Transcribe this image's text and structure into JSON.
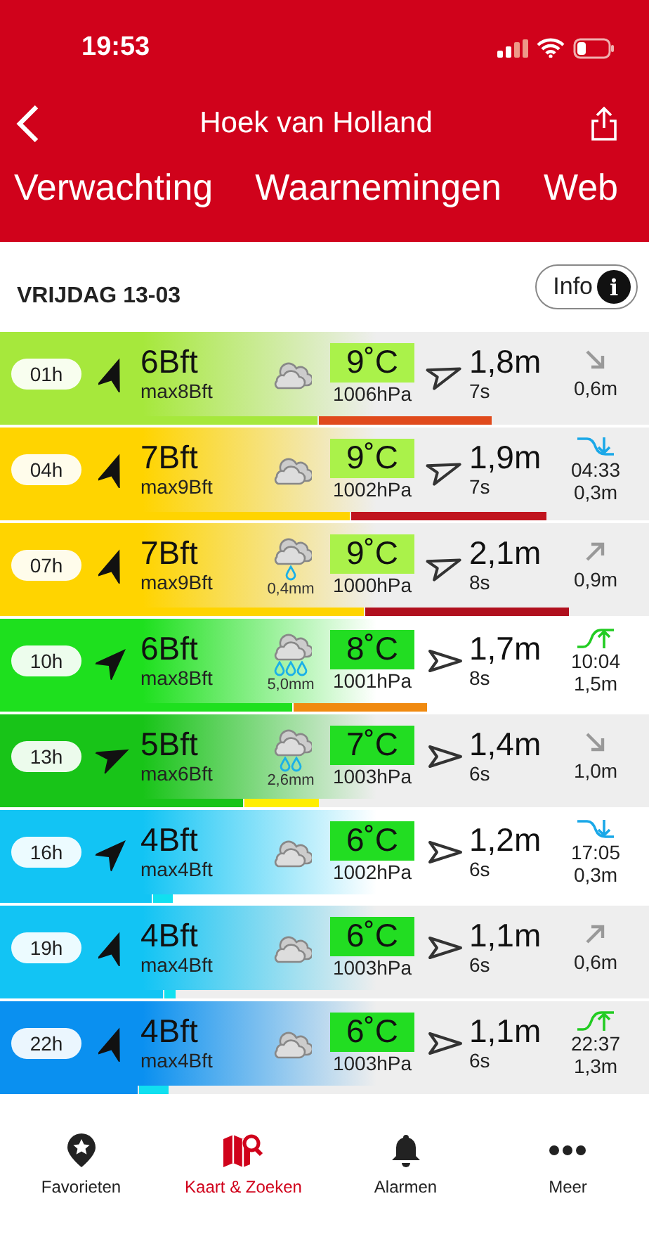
{
  "status_bar": {
    "time": "19:53"
  },
  "header": {
    "title": "Hoek van Holland"
  },
  "tabs": [
    "Verwachting",
    "Waarnemingen",
    "Web"
  ],
  "day": {
    "label": "VRIJDAG 13-03",
    "info_button": "Info",
    "info_icon": "i"
  },
  "rows": [
    {
      "hour": "01h",
      "shaded": true,
      "color": "#a6e83c",
      "wind": "6Bft",
      "gust": "max8Bft",
      "rain": {
        "kind": "none"
      },
      "temp": {
        "text": "9˚C",
        "color": "#aaf24a"
      },
      "pressure": "1006hPa",
      "wave": "1,8m",
      "period": "7s",
      "swell": {
        "kind": "arrow-down",
        "height": "0,6m"
      },
      "wind_bar": {
        "level": 0.49
      },
      "wave_bar": {
        "color": "#e04a1c"
      }
    },
    {
      "hour": "04h",
      "shaded": true,
      "color": "#ffd400",
      "wind": "7Bft",
      "gust": "max9Bft",
      "rain": {
        "kind": "none"
      },
      "temp": {
        "text": "9˚C",
        "color": "#aaf24a"
      },
      "pressure": "1002hPa",
      "wave": "1,9m",
      "period": "7s",
      "swell": {
        "kind": "tide-low",
        "time": "04:33",
        "height": "0,3m"
      },
      "wind_bar": {
        "level": 0.54
      },
      "wave_bar": {
        "color": "#c0141e"
      }
    },
    {
      "hour": "07h",
      "shaded": true,
      "color": "#ffd400",
      "wind": "7Bft",
      "gust": "max9Bft",
      "rain": {
        "kind": "light",
        "amount": "0,4mm"
      },
      "temp": {
        "text": "9˚C",
        "color": "#aaf24a"
      },
      "pressure": "1000hPa",
      "wave": "2,1m",
      "period": "8s",
      "swell": {
        "kind": "arrow-up",
        "height": "0,9m"
      },
      "wind_bar": {
        "level": 0.56
      },
      "wave_bar": {
        "color": "#b0101e"
      }
    },
    {
      "hour": "10h",
      "shaded": false,
      "color": "#1ee01e",
      "wind": "6Bft",
      "gust": "max8Bft",
      "rain": {
        "kind": "heavy",
        "amount": "5,0mm"
      },
      "temp": {
        "text": "8˚C",
        "color": "#22dd22"
      },
      "pressure": "1001hPa",
      "wave": "1,7m",
      "period": "8s",
      "swell": {
        "kind": "tide-high",
        "time": "10:04",
        "height": "1,5m"
      },
      "wind_bar": {
        "level": 0.45
      },
      "wave_bar": {
        "color": "#f08a10"
      }
    },
    {
      "hour": "13h",
      "shaded": true,
      "color": "#18c418",
      "wind": "5Bft",
      "gust": "max6Bft",
      "rain": {
        "kind": "moderate",
        "amount": "2,6mm"
      },
      "temp": {
        "text": "7˚C",
        "color": "#22dd22"
      },
      "pressure": "1003hPa",
      "wave": "1,4m",
      "period": "6s",
      "swell": {
        "kind": "arrow-down",
        "height": "1,0m"
      },
      "wind_bar": {
        "level": 0.375
      },
      "wave_bar": {
        "color": "#ffee00"
      }
    },
    {
      "hour": "16h",
      "shaded": false,
      "color": "#12c4f4",
      "wind": "4Bft",
      "gust": "max4Bft",
      "rain": {
        "kind": "none"
      },
      "temp": {
        "text": "6˚C",
        "color": "#22dd22"
      },
      "pressure": "1002hPa",
      "wave": "1,2m",
      "period": "6s",
      "swell": {
        "kind": "tide-low",
        "time": "17:05",
        "height": "0,3m"
      },
      "wind_bar": {
        "level": 0.233
      },
      "wave_bar": {
        "color": "#10e0f0"
      }
    },
    {
      "hour": "19h",
      "shaded": true,
      "color": "#12c4f4",
      "wind": "4Bft",
      "gust": "max4Bft",
      "rain": {
        "kind": "none"
      },
      "temp": {
        "text": "6˚C",
        "color": "#22dd22"
      },
      "pressure": "1003hPa",
      "wave": "1,1m",
      "period": "6s",
      "swell": {
        "kind": "arrow-up",
        "height": "0,6m"
      },
      "wind_bar": {
        "level": 0.25
      },
      "wave_bar": {
        "color": "#10e0f0"
      }
    },
    {
      "hour": "22h",
      "shaded": true,
      "color": "#0a90f0",
      "wind": "4Bft",
      "gust": "max4Bft",
      "rain": {
        "kind": "none"
      },
      "temp": {
        "text": "6˚C",
        "color": "#22dd22"
      },
      "pressure": "1003hPa",
      "wave": "1,1m",
      "period": "6s",
      "swell": {
        "kind": "tide-high",
        "time": "22:37",
        "height": "1,3m"
      },
      "wind_bar": {
        "level": 0.213
      },
      "wave_bar": {
        "color": "#10e0f0"
      }
    }
  ],
  "nav": [
    {
      "label": "Favorieten",
      "selected": false
    },
    {
      "label": "Kaart & Zoeken",
      "selected": true
    },
    {
      "label": "Alarmen",
      "selected": false
    },
    {
      "label": "Meer",
      "selected": false
    }
  ]
}
